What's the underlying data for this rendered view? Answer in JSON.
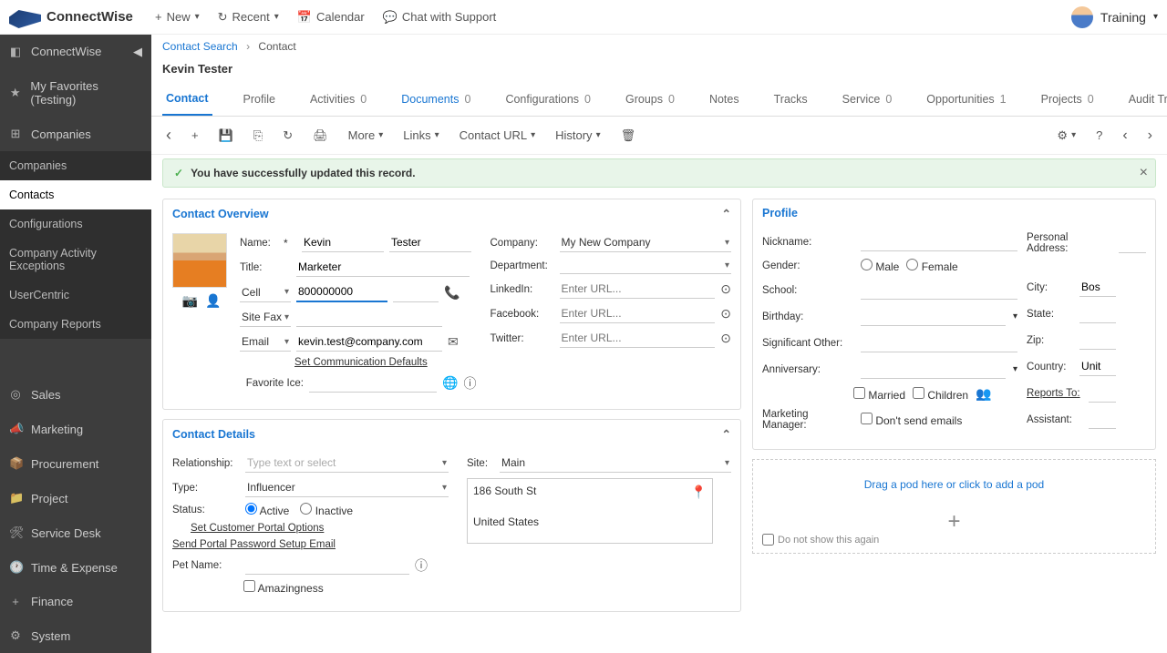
{
  "brand": "ConnectWise",
  "top": {
    "new": "New",
    "recent": "Recent",
    "calendar": "Calendar",
    "chat": "Chat with Support",
    "user": "Training"
  },
  "sidebar": {
    "main": [
      {
        "label": "ConnectWise",
        "icon": "◧"
      },
      {
        "label": "My Favorites (Testing)",
        "icon": "★"
      },
      {
        "label": "Companies",
        "icon": "⊞"
      }
    ],
    "sub": [
      "Companies",
      "Contacts",
      "Configurations",
      "Company Activity Exceptions",
      "UserCentric",
      "Company Reports"
    ],
    "sub_active": 1,
    "bottom": [
      {
        "label": "Sales",
        "icon": "◎"
      },
      {
        "label": "Marketing",
        "icon": "📣"
      },
      {
        "label": "Procurement",
        "icon": "📦"
      },
      {
        "label": "Project",
        "icon": "📁"
      },
      {
        "label": "Service Desk",
        "icon": "🛠"
      },
      {
        "label": "Time & Expense",
        "icon": "🕐"
      },
      {
        "label": "Finance",
        "icon": "+"
      },
      {
        "label": "System",
        "icon": "⚙"
      }
    ]
  },
  "crumb": {
    "search": "Contact Search",
    "current": "Contact"
  },
  "page_title": "Kevin Tester",
  "tabs": [
    {
      "label": "Contact",
      "active": true
    },
    {
      "label": "Profile"
    },
    {
      "label": "Activities",
      "count": "0"
    },
    {
      "label": "Documents",
      "count": "0",
      "link": true
    },
    {
      "label": "Configurations",
      "count": "0"
    },
    {
      "label": "Groups",
      "count": "0"
    },
    {
      "label": "Notes"
    },
    {
      "label": "Tracks"
    },
    {
      "label": "Service",
      "count": "0"
    },
    {
      "label": "Opportunities",
      "count": "1"
    },
    {
      "label": "Projects",
      "count": "0"
    },
    {
      "label": "Audit Trail"
    }
  ],
  "toolbar": {
    "more": "More",
    "links": "Links",
    "contact_url": "Contact URL",
    "history": "History"
  },
  "alert": "You have successfully updated this record.",
  "overview": {
    "header": "Contact Overview",
    "name_lbl": "Name:",
    "required": "*",
    "first": "Kevin",
    "last": "Tester",
    "title_lbl": "Title:",
    "title": "Marketer",
    "cell_lbl": "Cell",
    "cell": "800000000",
    "fax_lbl": "Site Fax",
    "email_lbl": "Email",
    "email": "kevin.test@company.com",
    "comm_defaults": "Set Communication Defaults",
    "fav_ice_lbl": "Favorite Ice:",
    "company_lbl": "Company:",
    "company": "My New Company",
    "dept_lbl": "Department:",
    "linkedin_lbl": "LinkedIn:",
    "facebook_lbl": "Facebook:",
    "twitter_lbl": "Twitter:",
    "url_ph": "Enter URL..."
  },
  "details": {
    "header": "Contact Details",
    "rel_lbl": "Relationship:",
    "rel_ph": "Type text or select",
    "type_lbl": "Type:",
    "type": "Influencer",
    "status_lbl": "Status:",
    "active": "Active",
    "inactive": "Inactive",
    "portal": "Set Customer Portal Options",
    "pwd_email": "Send Portal Password Setup Email",
    "pet_lbl": "Pet Name:",
    "amazing": "Amazingness",
    "site_lbl": "Site:",
    "site": "Main",
    "addr1": "186 South St",
    "addr2": "United States"
  },
  "profile": {
    "header": "Profile",
    "nick_lbl": "Nickname:",
    "gender_lbl": "Gender:",
    "male": "Male",
    "female": "Female",
    "school_lbl": "School:",
    "bday_lbl": "Birthday:",
    "so_lbl": "Significant Other:",
    "anniv_lbl": "Anniversary:",
    "married": "Married",
    "children": "Children",
    "mgr_lbl": "Marketing Manager:",
    "no_emails": "Don't send emails",
    "paddr_lbl": "Personal Address:",
    "city_lbl": "City:",
    "city": "Bos",
    "state_lbl": "State:",
    "zip_lbl": "Zip:",
    "country_lbl": "Country:",
    "country": "Unit",
    "reports_lbl": "Reports To:",
    "assistant_lbl": "Assistant:"
  },
  "pod": {
    "drag": "Drag a pod here or click to add a pod",
    "noshow": "Do not show this again"
  }
}
